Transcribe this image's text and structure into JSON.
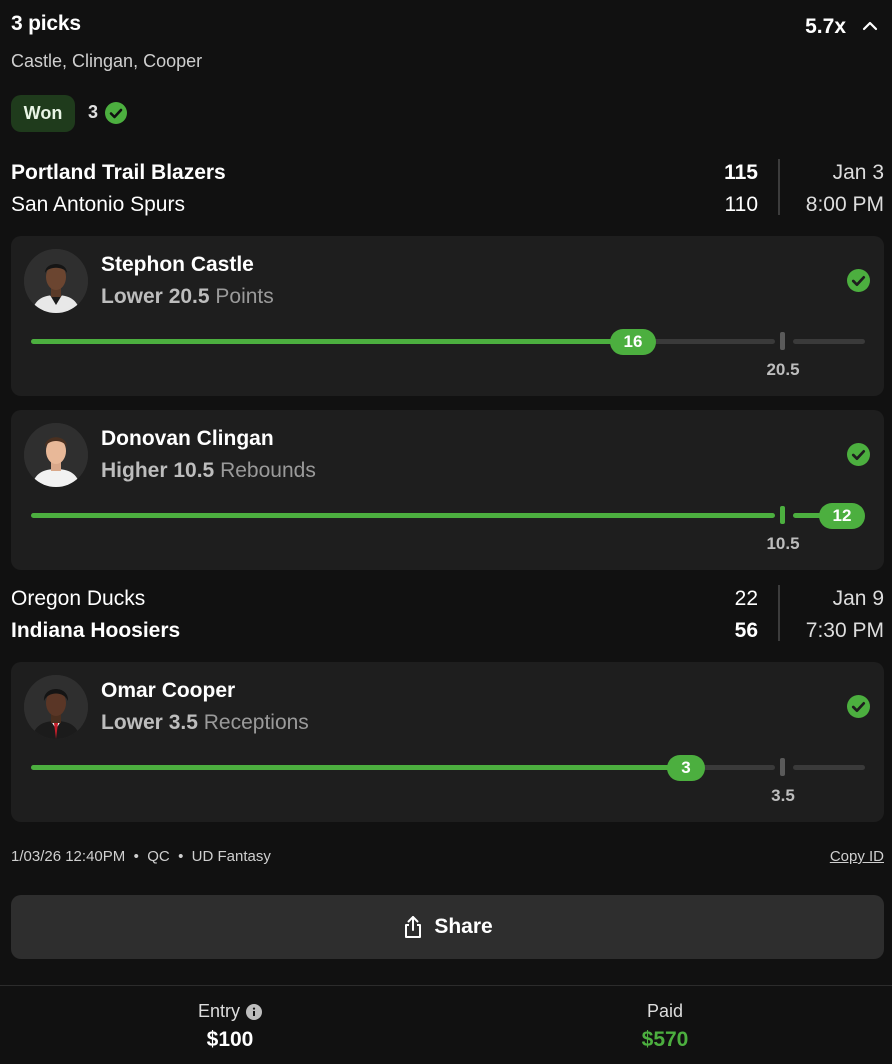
{
  "header": {
    "title": "3 picks",
    "multiplier": "5.7x",
    "players": "Castle, Clingan, Cooper"
  },
  "status": {
    "badge": "Won",
    "count": "3"
  },
  "colors": {
    "accent": "#4caf3f",
    "background": "#111111",
    "card": "#1e1e1e"
  },
  "games": [
    {
      "team1": "Portland Trail Blazers",
      "score1": "115",
      "team2": "San Antonio Spurs",
      "score2": "110",
      "date": "Jan 3",
      "time": "8:00 PM",
      "picks": [
        {
          "name": "Stephon Castle",
          "direction": "Lower",
          "line": "20.5",
          "stat": "Points",
          "result": "16",
          "line_label": "20.5"
        },
        {
          "name": "Donovan Clingan",
          "direction": "Higher",
          "line": "10.5",
          "stat": "Rebounds",
          "result": "12",
          "line_label": "10.5"
        }
      ]
    },
    {
      "team1": "Oregon Ducks",
      "score1": "22",
      "team2": "Indiana Hoosiers",
      "score2": "56",
      "date": "Jan 9",
      "time": "7:30 PM",
      "picks": [
        {
          "name": "Omar Cooper",
          "direction": "Lower",
          "line": "3.5",
          "stat": "Receptions",
          "result": "3",
          "line_label": "3.5"
        }
      ]
    }
  ],
  "meta": {
    "timestamp": "1/03/26 12:40PM",
    "sep": "•",
    "location": "QC",
    "product": "UD Fantasy",
    "copy_id": "Copy ID"
  },
  "share": {
    "label": "Share",
    "icon": "share-icon"
  },
  "footer": {
    "entry_label": "Entry",
    "entry_value": "$100",
    "paid_label": "Paid",
    "paid_value": "$570"
  }
}
